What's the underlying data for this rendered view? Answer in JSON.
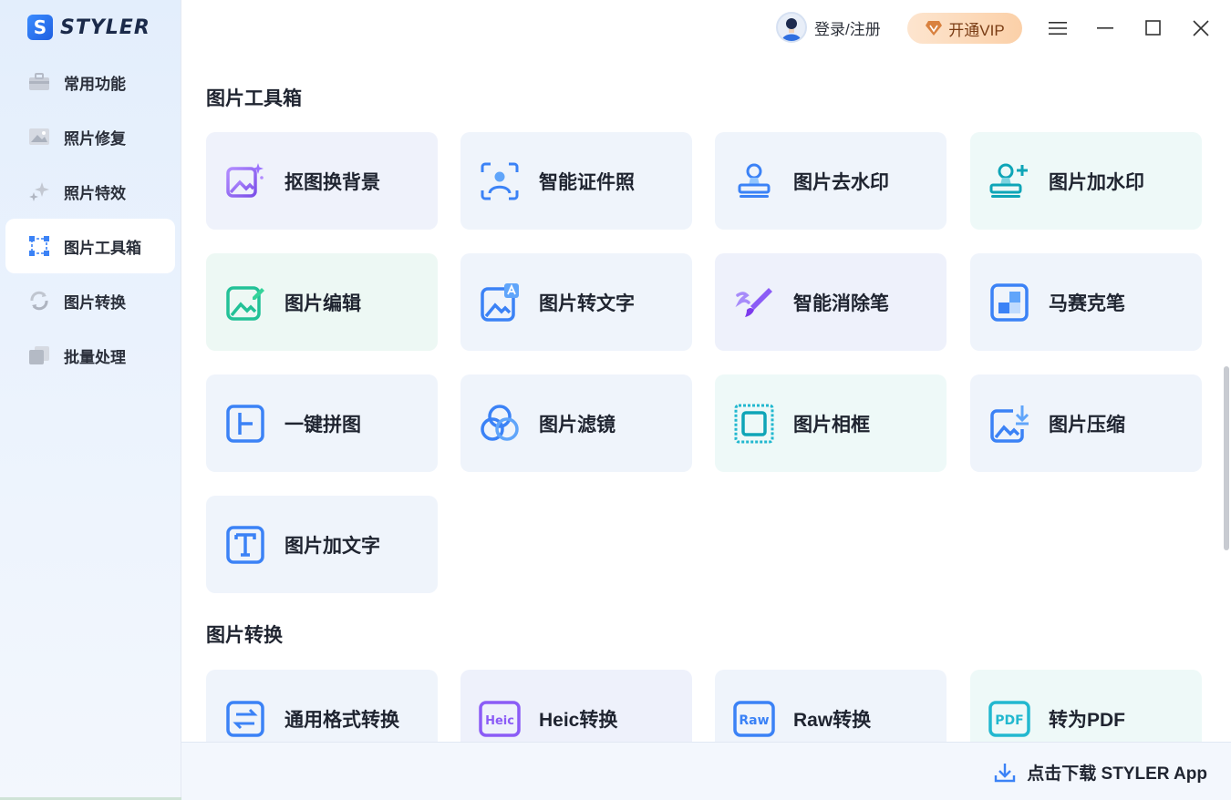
{
  "app": {
    "logo_text": "STYLER",
    "logo_letter": "S"
  },
  "sidebar": {
    "items": [
      {
        "label": "常用功能",
        "icon": "briefcase-icon"
      },
      {
        "label": "照片修复",
        "icon": "image-repair-icon"
      },
      {
        "label": "照片特效",
        "icon": "sparkle-effects-icon"
      },
      {
        "label": "图片工具箱",
        "icon": "selection-frame-icon",
        "active": true
      },
      {
        "label": "图片转换",
        "icon": "convert-cycle-icon"
      },
      {
        "label": "批量处理",
        "icon": "stack-batch-icon"
      }
    ]
  },
  "header": {
    "login_label": "登录/注册",
    "vip_label": "开通VIP"
  },
  "sections": [
    {
      "title": "图片工具箱",
      "cards": [
        {
          "label": "抠图换背景",
          "icon": "cutout-background-icon"
        },
        {
          "label": "智能证件照",
          "icon": "id-photo-icon"
        },
        {
          "label": "图片去水印",
          "icon": "remove-watermark-icon"
        },
        {
          "label": "图片加水印",
          "icon": "add-watermark-icon"
        },
        {
          "label": "图片编辑",
          "icon": "image-edit-icon"
        },
        {
          "label": "图片转文字",
          "icon": "image-to-text-icon"
        },
        {
          "label": "智能消除笔",
          "icon": "eraser-brush-icon"
        },
        {
          "label": "马赛克笔",
          "icon": "mosaic-icon"
        },
        {
          "label": "一键拼图",
          "icon": "collage-icon"
        },
        {
          "label": "图片滤镜",
          "icon": "filter-icon"
        },
        {
          "label": "图片相框",
          "icon": "photo-frame-icon"
        },
        {
          "label": "图片压缩",
          "icon": "compress-icon"
        },
        {
          "label": "图片加文字",
          "icon": "add-text-icon"
        }
      ]
    },
    {
      "title": "图片转换",
      "cards": [
        {
          "label": "通用格式转换",
          "icon": "format-convert-icon"
        },
        {
          "label": "Heic转换",
          "icon": "heic-icon",
          "badge": "Heic"
        },
        {
          "label": "Raw转换",
          "icon": "raw-icon",
          "badge": "Raw"
        },
        {
          "label": "转为PDF",
          "icon": "pdf-icon",
          "badge": "PDF"
        }
      ]
    }
  ],
  "footer": {
    "download_label": "点击下载 STYLER App"
  },
  "colors": {
    "accent": "#3b82f6",
    "purple": "#8b5cf6",
    "teal": "#22c1b8",
    "vip_text": "#7a3c14"
  }
}
